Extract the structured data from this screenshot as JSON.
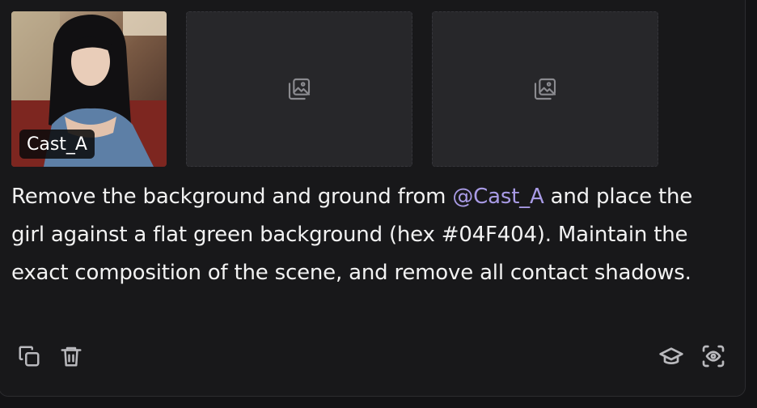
{
  "reference": {
    "tag_label": "Cast_A",
    "image_desc_icon": "portrait-photo"
  },
  "slots": [
    {
      "icon": "image-placeholder-icon"
    },
    {
      "icon": "image-placeholder-icon"
    }
  ],
  "prompt": {
    "before": "Remove the background and ground from ",
    "mention": "@Cast_A",
    "after": " and place the girl against a flat green background (hex #04F404). Maintain the exact composition of the scene, and remove all contact shadows."
  },
  "actions": {
    "left": [
      "copy-icon",
      "trash-icon"
    ],
    "right": [
      "graduation-cap-icon",
      "eye-scan-icon"
    ]
  },
  "colors": {
    "mention": "#a99be6",
    "background": "#18181a",
    "placeholder": "#27272a"
  }
}
